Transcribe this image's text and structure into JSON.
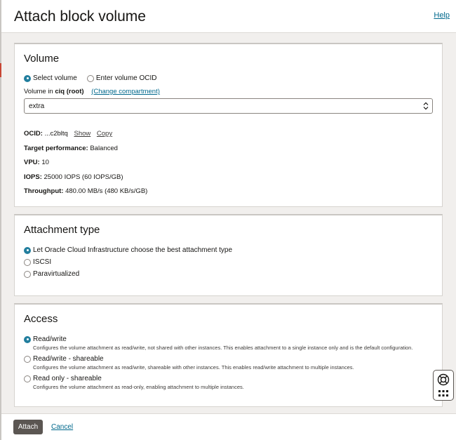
{
  "header": {
    "title": "Attach block volume",
    "help_label": "Help"
  },
  "volume": {
    "title": "Volume",
    "options": [
      "Select volume",
      "Enter volume OCID"
    ],
    "selected_option": "Select volume",
    "compartment_prefix": "Volume in",
    "compartment_name": "ciq (root)",
    "change_compartment_label": "(Change compartment)",
    "selected_volume": "extra",
    "ocid_label": "OCID:",
    "ocid_value": "...c2bltq",
    "show_label": "Show",
    "copy_label": "Copy",
    "target_performance_label": "Target performance:",
    "target_performance_value": "Balanced",
    "vpu_label": "VPU:",
    "vpu_value": "10",
    "iops_label": "IOPS:",
    "iops_value": "25000 IOPS (60 IOPS/GB)",
    "throughput_label": "Throughput:",
    "throughput_value": "480.00 MB/s (480 KB/s/GB)"
  },
  "attachment_type": {
    "title": "Attachment type",
    "options": [
      "Let Oracle Cloud Infrastructure choose the best attachment type",
      "ISCSI",
      "Paravirtualized"
    ],
    "selected_option": "Let Oracle Cloud Infrastructure choose the best attachment type"
  },
  "access": {
    "title": "Access",
    "options": [
      {
        "label": "Read/write",
        "description": "Configures the volume attachment as read/write, not shared with other instances. This enables attachment to a single instance only and is the default configuration."
      },
      {
        "label": "Read/write - shareable",
        "description": "Configures the volume attachment as read/write, shareable with other instances. This enables read/write attachment to multiple instances."
      },
      {
        "label": "Read only - shareable",
        "description": "Configures the volume attachment as read-only, enabling attachment to multiple instances."
      }
    ],
    "selected_option": "Read/write"
  },
  "footer": {
    "attach_label": "Attach",
    "cancel_label": "Cancel"
  },
  "icons": {
    "help_widget": "lifebuoy-icon",
    "apps": "grid-dots-icon",
    "select_chevron": "chevron-up-down-icon"
  },
  "colors": {
    "accent": "#227e9e",
    "link": "#00688c",
    "primary_button": "#5b5652",
    "page_background": "#f1efed"
  }
}
